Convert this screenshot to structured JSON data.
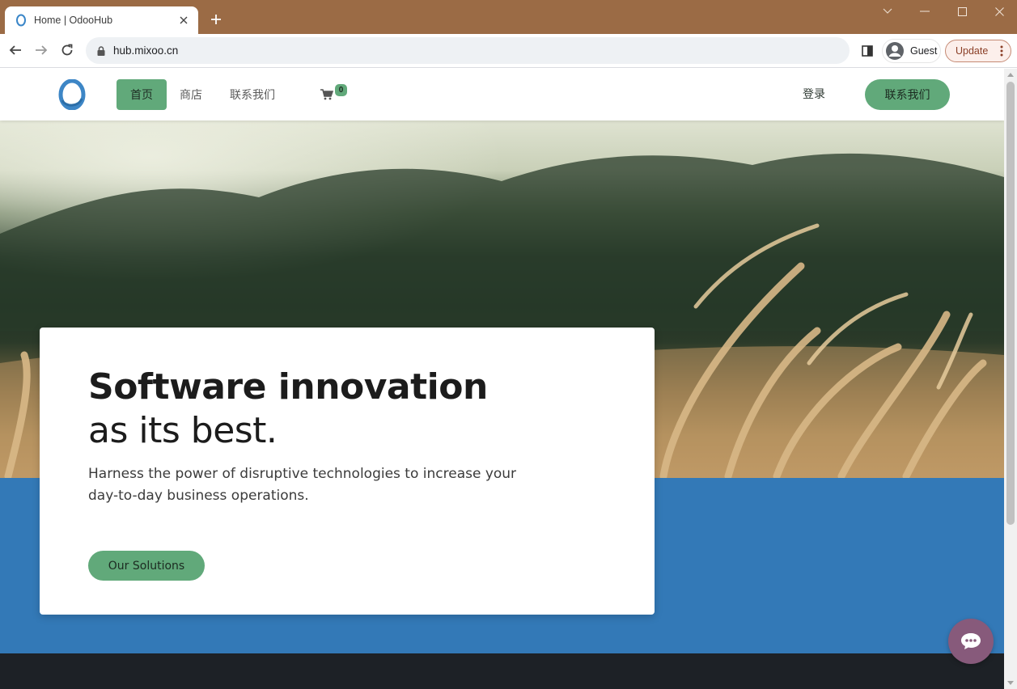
{
  "browser": {
    "tab_title": "Home | OdooHub",
    "url": "hub.mixoo.cn",
    "profile_label": "Guest",
    "update_label": "Update",
    "titlebar_color": "#9b6b45"
  },
  "site": {
    "menu": [
      {
        "label": "首页",
        "active": true
      },
      {
        "label": "商店",
        "active": false
      },
      {
        "label": "联系我们",
        "active": false
      }
    ],
    "cart_count": "0",
    "login_label": "登录",
    "cta_label": "联系我们",
    "accent_color": "#61a97a"
  },
  "hero": {
    "title": "Software innovation",
    "subtitle": "as its best.",
    "text": "Harness the power of disruptive technologies to increase your day-to-day business operations.",
    "button_label": "Our Solutions",
    "band_color": "#3379b7"
  },
  "icons": {
    "chat": "chat-bubble-icon",
    "cart": "shopping-cart-icon"
  }
}
